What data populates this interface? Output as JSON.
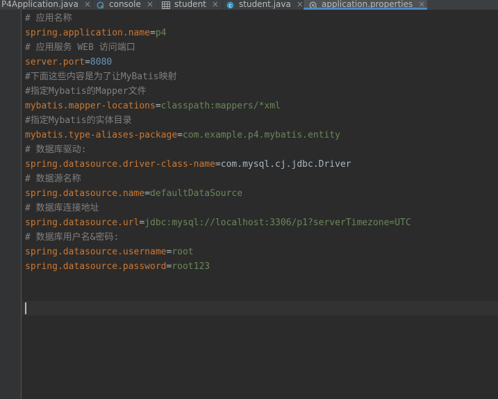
{
  "tabs": [
    {
      "label": "P4Application.java",
      "icon": "java-class-icon",
      "active": false
    },
    {
      "label": "console",
      "icon": "console-icon",
      "active": false
    },
    {
      "label": "student",
      "icon": "table-icon",
      "active": false
    },
    {
      "label": "student.java",
      "icon": "java-class-icon",
      "active": false
    },
    {
      "label": "application.properties",
      "icon": "properties-file-icon",
      "active": true
    }
  ],
  "close_glyph": "×",
  "lines": [
    {
      "type": "comment",
      "text": "# 应用名称"
    },
    {
      "type": "prop",
      "key": "spring.application.name",
      "eq": "=",
      "value": "p4"
    },
    {
      "type": "comment",
      "text": "# 应用服务 WEB 访问端口"
    },
    {
      "type": "prop",
      "key": "server.port",
      "eq": "=",
      "value": "8080"
    },
    {
      "type": "comment",
      "text": "#下面这些内容是为了让MyBatis映射"
    },
    {
      "type": "comment",
      "text": "#指定Mybatis的Mapper文件"
    },
    {
      "type": "prop",
      "key": "mybatis.mapper-locations",
      "eq": "=",
      "value": "classpath:mappers/*xml"
    },
    {
      "type": "comment",
      "text": "#指定Mybatis的实体目录"
    },
    {
      "type": "prop",
      "key": "mybatis.type-aliases-package",
      "eq": "=",
      "value": "com.example.p4.mybatis.entity"
    },
    {
      "type": "comment",
      "text": "# 数据库驱动:"
    },
    {
      "type": "prop",
      "key": "spring.datasource.driver-class-name",
      "eq": "=",
      "value": "com.mysql.cj.jdbc.Driver"
    },
    {
      "type": "comment",
      "text": "# 数据源名称"
    },
    {
      "type": "prop",
      "key": "spring.datasource.name",
      "eq": "=",
      "value": "defaultDataSource"
    },
    {
      "type": "comment",
      "text": "# 数据库连接地址"
    },
    {
      "type": "prop",
      "key": "spring.datasource.url",
      "eq": "=",
      "value": "jdbc:mysql://localhost:3306/p1?serverTimezone=UTC"
    },
    {
      "type": "comment",
      "text": "# 数据库用户名&密码:"
    },
    {
      "type": "prop",
      "key": "spring.datasource.username",
      "eq": "=",
      "value": "root"
    },
    {
      "type": "prop",
      "key": "spring.datasource.password",
      "eq": "=",
      "value": "root123"
    }
  ],
  "colors": {
    "background": "#2b2b2b",
    "comment": "#808080",
    "key": "#cc7832",
    "value": "#6a8759",
    "number": "#6897bb",
    "accent": "#4a88c7"
  }
}
